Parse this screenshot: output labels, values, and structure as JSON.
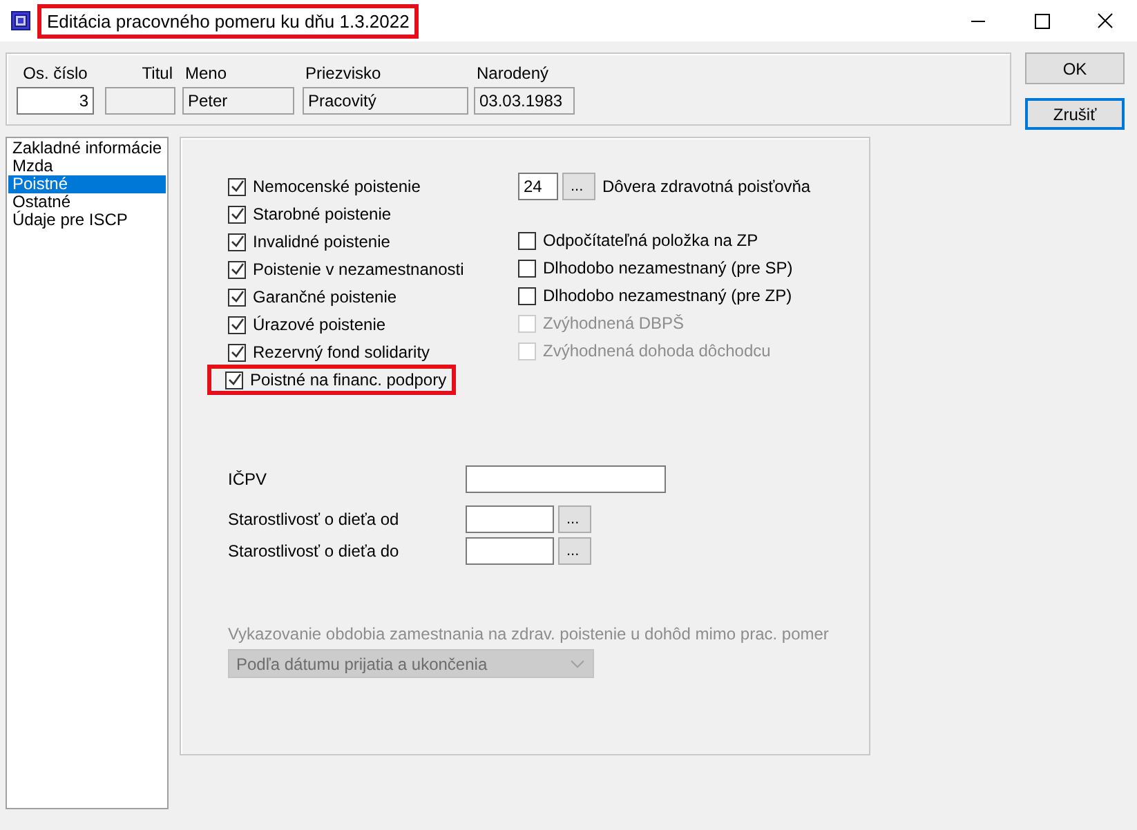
{
  "window": {
    "title": {
      "text": "Editácia pracovného pomeru ku dňu  1.3.2022",
      "highlighted": true
    }
  },
  "header_fields": [
    {
      "label": "Os. číslo",
      "value": "3",
      "editable": true
    },
    {
      "label": "Titul",
      "editable": false
    },
    {
      "label": "Meno",
      "value": "Peter",
      "editable": false
    },
    {
      "label": "Priezvisko",
      "value": "Pracovitý",
      "editable": false
    },
    {
      "label": "Narodený",
      "value": "03.03.1983",
      "editable": false
    }
  ],
  "buttons": [
    {
      "label": "OK",
      "default": false
    },
    {
      "label": "Zrušiť",
      "default": true
    }
  ],
  "sidebar": {
    "items": [
      {
        "label": "Zakladné informácie",
        "selected": false
      },
      {
        "label": "Mzda",
        "selected": false
      },
      {
        "label": "Poistné",
        "selected": true
      },
      {
        "label": "Ostatné",
        "selected": false
      },
      {
        "label": "Údaje pre ISCP",
        "selected": false
      }
    ]
  },
  "insurance_checks": [
    {
      "label": "Nemocenské poistenie",
      "checked": true,
      "highlighted": false
    },
    {
      "label": "Starobné poistenie",
      "checked": true,
      "highlighted": false
    },
    {
      "label": "Invalidné poistenie",
      "checked": true,
      "highlighted": false
    },
    {
      "label": "Poistenie v nezamestnanosti",
      "checked": true,
      "highlighted": false
    },
    {
      "label": "Garančné poistenie",
      "checked": true,
      "highlighted": false
    },
    {
      "label": "Úrazové poistenie",
      "checked": true,
      "highlighted": false
    },
    {
      "label": "Rezervný fond solidarity",
      "checked": true,
      "highlighted": false
    },
    {
      "label": "Poistné na financ. podpory",
      "checked": true,
      "highlighted": true
    }
  ],
  "health_insurer": {
    "code": "24",
    "button": "...",
    "label": "Dôvera zdravotná poisťovňa"
  },
  "other_checks": [
    {
      "label": "Odpočítateľná položka na ZP",
      "checked": false,
      "disabled": false
    },
    {
      "label": "Dlhodobo nezamestnaný (pre SP)",
      "checked": false,
      "disabled": false
    },
    {
      "label": "Dlhodobo nezamestnaný (pre ZP)",
      "checked": false,
      "disabled": false
    },
    {
      "label": "Zvýhodnená DBPŠ",
      "checked": false,
      "disabled": true
    },
    {
      "label": "Zvýhodnená dohoda dôchodcu",
      "checked": false,
      "disabled": true
    }
  ],
  "form_fields": [
    {
      "label": "IČPV",
      "kind": "text"
    },
    {
      "label": "Starostlivosť o dieťa od",
      "kind": "date",
      "button": "..."
    },
    {
      "label": "Starostlivosť o dieťa do",
      "kind": "date",
      "button": "..."
    }
  ],
  "reporting": {
    "label": "Vykazovanie obdobia zamestnania na zdrav. poistenie u dohôd mimo prac. pomer",
    "value": "Podľa dátumu prijatia a ukončenia",
    "disabled": true
  }
}
